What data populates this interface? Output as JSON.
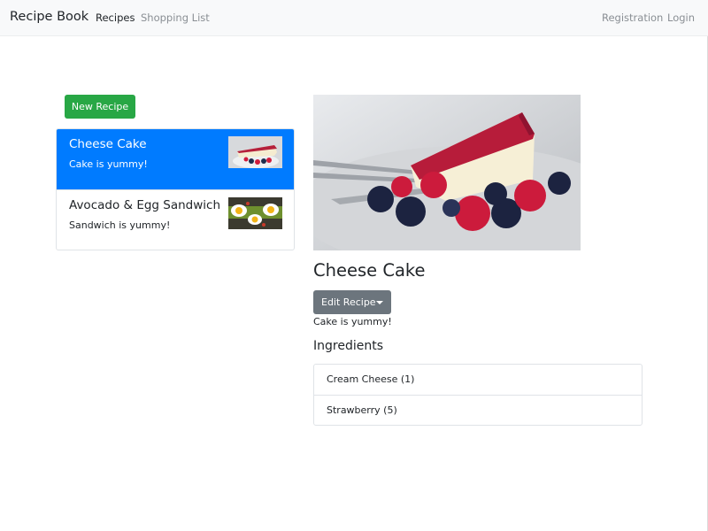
{
  "navbar": {
    "brand": "Recipe Book",
    "links": [
      {
        "label": "Recipes",
        "active": true
      },
      {
        "label": "Shopping List",
        "active": false
      }
    ],
    "right_links": [
      {
        "label": "Registration"
      },
      {
        "label": "Login"
      }
    ]
  },
  "actions": {
    "new_recipe_label": "New Recipe"
  },
  "recipes": [
    {
      "name": "Cheese Cake",
      "description": "Cake is yummy!",
      "active": true,
      "image_icon": "cheesecake-thumbnail"
    },
    {
      "name": "Avocado & Egg Sandwich",
      "description": "Sandwich is yummy!",
      "active": false,
      "image_icon": "sandwich-thumbnail"
    }
  ],
  "detail": {
    "title": "Cheese Cake",
    "edit_label": "Edit Recipe",
    "description": "Cake is yummy!",
    "ingredients_heading": "Ingredients",
    "ingredients": [
      {
        "text": "Cream Cheese (1)"
      },
      {
        "text": "Strawberry (5)"
      }
    ],
    "image_icon": "cheesecake-photo"
  },
  "colors": {
    "primary": "#007bff",
    "success": "#28a745",
    "secondary": "#6c757d",
    "navbar_bg": "#f8f9fa"
  }
}
